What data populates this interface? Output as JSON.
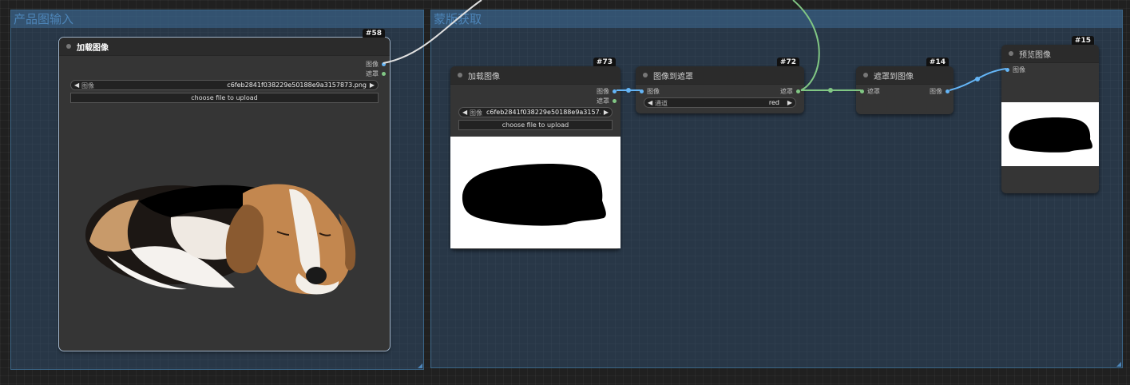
{
  "groups": {
    "product_input": {
      "title": "产品图输入"
    },
    "mask_extract": {
      "title": "蒙版获取"
    }
  },
  "nodes": {
    "n58": {
      "id": "#58",
      "title": "加载图像",
      "outputs": [
        "图像",
        "遮罩"
      ],
      "image_widget": {
        "label": "图像",
        "value": "c6feb2841f038229e50188e9a3157873.png"
      },
      "upload_label": "choose file to upload"
    },
    "n73": {
      "id": "#73",
      "title": "加载图像",
      "outputs": [
        "图像",
        "遮罩"
      ],
      "image_widget": {
        "label": "图像",
        "value": "c6feb2841f038229e50188e9a3157..."
      },
      "upload_label": "choose file to upload"
    },
    "n72": {
      "id": "#72",
      "title": "图像到遮罩",
      "input": "图像",
      "output": "遮罩",
      "channel_widget": {
        "label": "通道",
        "value": "red"
      }
    },
    "n14": {
      "id": "#14",
      "title": "遮罩到图像",
      "input": "遮罩",
      "output": "图像"
    },
    "n15": {
      "id": "#15",
      "title": "预览图像",
      "input": "图像"
    }
  },
  "colors": {
    "image_link": "#64b5f6",
    "mask_link": "#81c784",
    "external_link": "#e0e0e0",
    "group_title": "#4d85b8"
  }
}
